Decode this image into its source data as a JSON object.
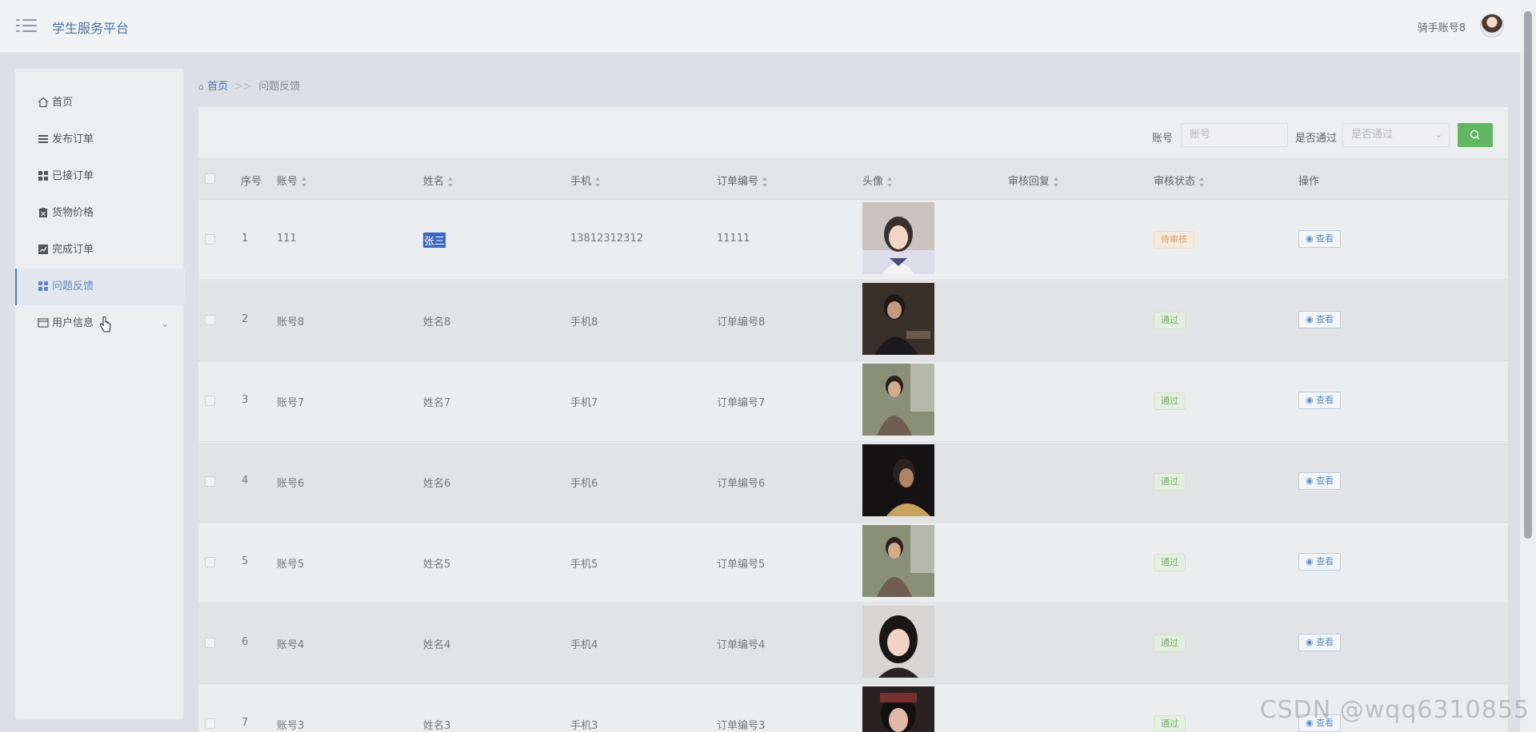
{
  "header": {
    "title": "学生服务平台",
    "user_name": "骑手账号8"
  },
  "sidebar": {
    "items": [
      {
        "label": "首页",
        "icon": "home-icon"
      },
      {
        "label": "发布订单",
        "icon": "list-icon"
      },
      {
        "label": "已接订单",
        "icon": "grid-icon"
      },
      {
        "label": "货物价格",
        "icon": "clipboard-icon"
      },
      {
        "label": "完成订单",
        "icon": "chart-icon"
      },
      {
        "label": "问题反馈",
        "icon": "grid-icon",
        "active": true
      },
      {
        "label": "用户信息",
        "icon": "card-icon",
        "expandable": true
      }
    ]
  },
  "breadcrumb": {
    "home": "首页",
    "separator": ">>",
    "current": "问题反馈"
  },
  "search": {
    "account_label": "账号",
    "account_placeholder": "账号",
    "passed_label": "是否通过",
    "passed_placeholder": "是否通过"
  },
  "table": {
    "headers": [
      "序号",
      "账号",
      "姓名",
      "手机",
      "订单编号",
      "头像",
      "审核回复",
      "审核状态",
      "操作"
    ],
    "view_label": "查看",
    "rows": [
      {
        "no": "1",
        "account": "111",
        "name": "张三",
        "phone": "13812312312",
        "order": "11111",
        "status": "待审核",
        "status_type": "pending"
      },
      {
        "no": "2",
        "account": "账号8",
        "name": "姓名8",
        "phone": "手机8",
        "order": "订单编号8",
        "status": "通过",
        "status_type": "pass"
      },
      {
        "no": "3",
        "account": "账号7",
        "name": "姓名7",
        "phone": "手机7",
        "order": "订单编号7",
        "status": "通过",
        "status_type": "pass"
      },
      {
        "no": "4",
        "account": "账号6",
        "name": "姓名6",
        "phone": "手机6",
        "order": "订单编号6",
        "status": "通过",
        "status_type": "pass"
      },
      {
        "no": "5",
        "account": "账号5",
        "name": "姓名5",
        "phone": "手机5",
        "order": "订单编号5",
        "status": "通过",
        "status_type": "pass"
      },
      {
        "no": "6",
        "account": "账号4",
        "name": "姓名4",
        "phone": "手机4",
        "order": "订单编号4",
        "status": "通过",
        "status_type": "pass"
      },
      {
        "no": "7",
        "account": "账号3",
        "name": "姓名3",
        "phone": "手机3",
        "order": "订单编号3",
        "status": "通过",
        "status_type": "pass"
      }
    ]
  },
  "watermark": "CSDN @wqq6310855",
  "colors": {
    "accent": "#4a74a8",
    "search_button": "#5fb760",
    "pending": "#e39a56",
    "pass": "#72b35f"
  }
}
